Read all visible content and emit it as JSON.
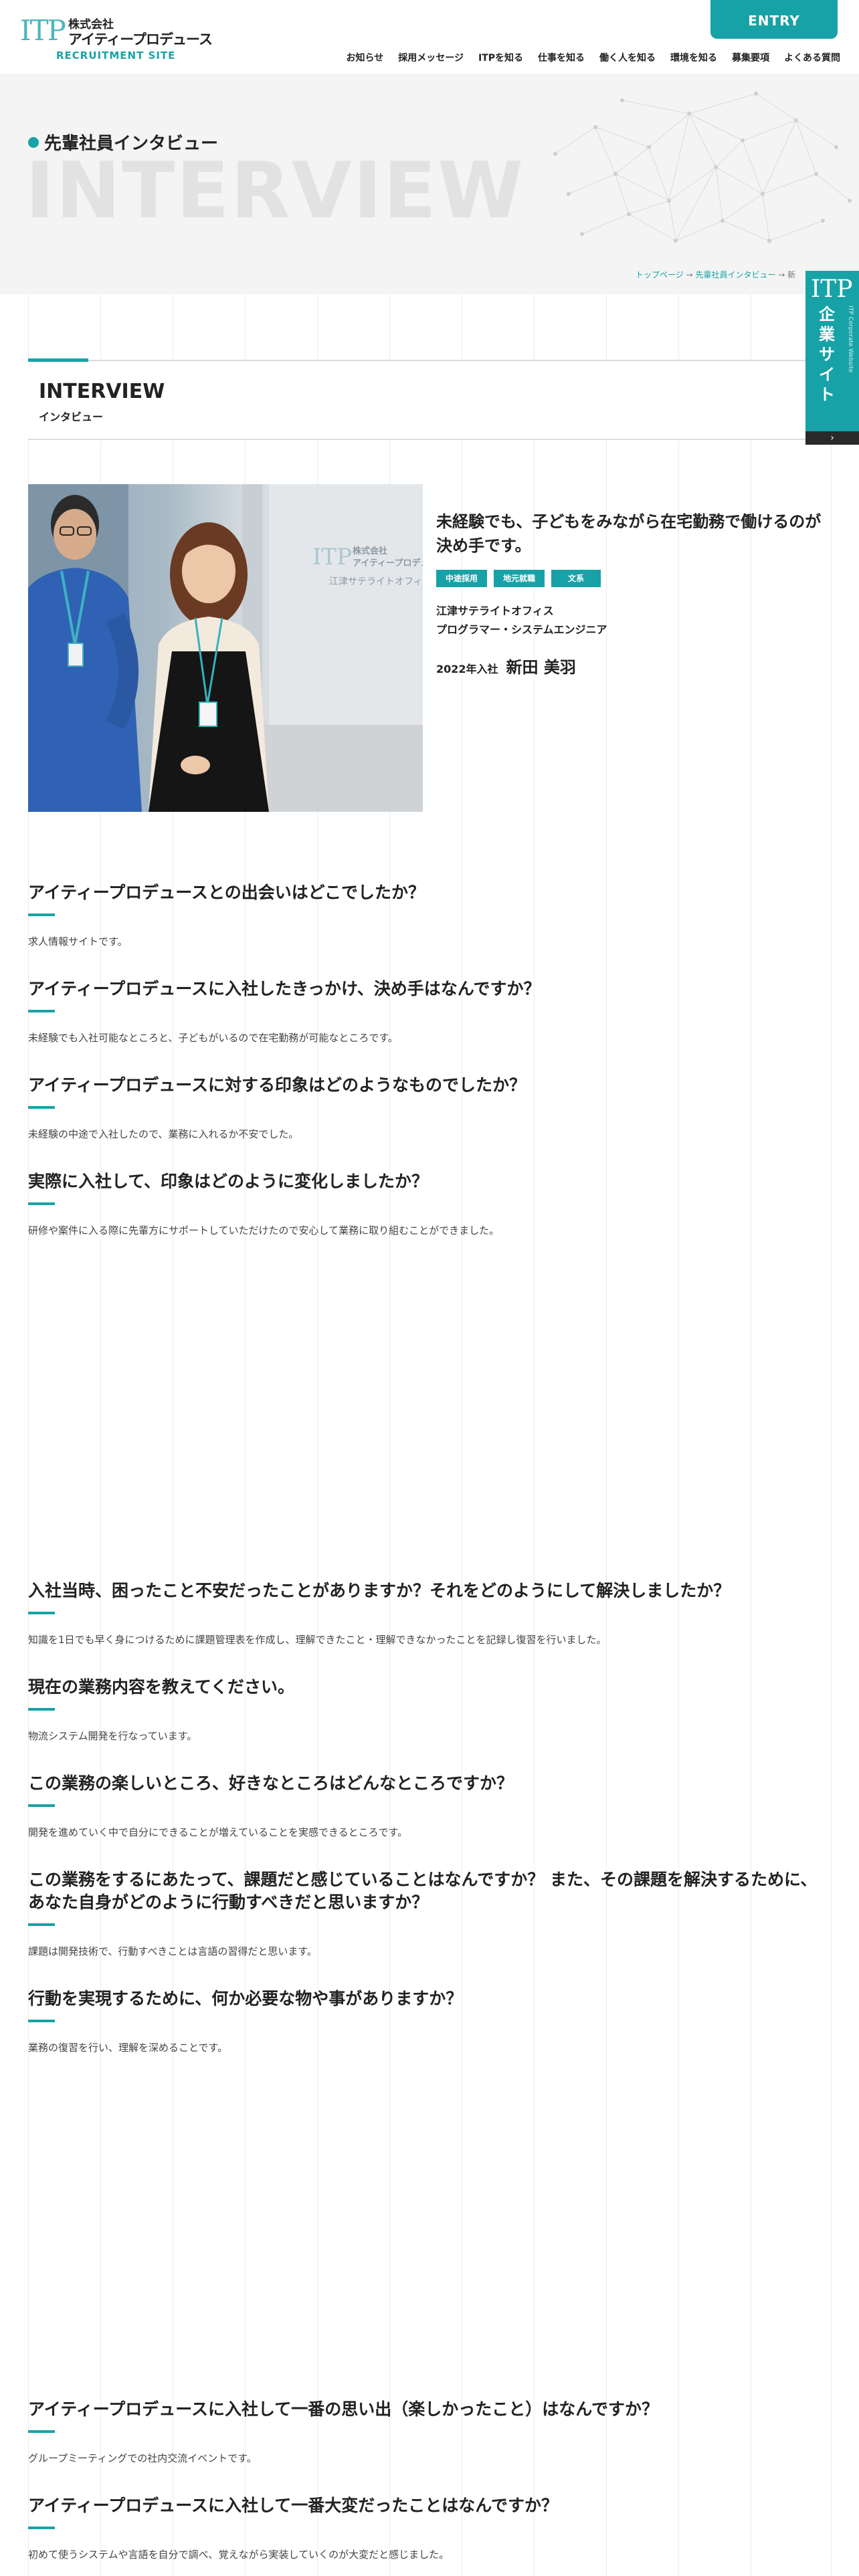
{
  "header": {
    "logo": {
      "itp": "ITP",
      "name_line1": "株式会社",
      "name_line2": "アイティープロデュース",
      "subtitle": "RECRUITMENT SITE"
    },
    "entry_label": "ENTRY",
    "nav": [
      "お知らせ",
      "採用メッセージ",
      "ITPを知る",
      "仕事を知る",
      "働く人を知る",
      "環境を知る",
      "募集要項",
      "よくある質問"
    ]
  },
  "hero": {
    "title": "先輩社員インタビュー",
    "title_en": "INTERVIEW"
  },
  "breadcrumb": {
    "home": "トップページ",
    "sep1": " → ",
    "parent": "先輩社員インタビュー",
    "sep2": " → ",
    "current": "新"
  },
  "side_tab": {
    "itp": "ITP",
    "label": "企業サイト",
    "small": "ITP Corporate Website",
    "arrow": "›"
  },
  "section": {
    "title_en": "INTERVIEW",
    "title_jp": "インタビュー"
  },
  "profile": {
    "catch": "未経験でも、子どもをみながら在宅勤務で働けるのが決め手です。",
    "tags": [
      "中途採用",
      "地元就職",
      "文系"
    ],
    "office": "江津サテライトオフィス",
    "job": "プログラマー・システムエンジニア",
    "joined_year": "2022年入社",
    "name": "新田 美羽",
    "photo_sign_itp": "ITP",
    "photo_sign_line1": "株式会社",
    "photo_sign_line2": "アイティープロデュース",
    "photo_sign_office": "江津サテライトオフィ"
  },
  "qa": [
    {
      "q": "アイティープロデュースとの出会いはどこでしたか？",
      "a": "求人情報サイトです。"
    },
    {
      "q": "アイティープロデュースに入社したきっかけ、決め手はなんですか？",
      "a": "未経験でも入社可能なところと、子どもがいるので在宅勤務が可能なところです。"
    },
    {
      "q": "アイティープロデュースに対する印象はどのようなものでしたか？",
      "a": "未経験の中途で入社したので、業務に入れるか不安でした。"
    },
    {
      "q": "実際に入社して、印象はどのように変化しましたか？",
      "a": "研修や案件に入る際に先輩方にサポートしていただけたので安心して業務に取り組むことができました。"
    },
    {
      "q": "入社当時、困ったこと不安だったことがありますか？それをどのようにして解決しましたか？",
      "a": "知識を1日でも早く身につけるために課題管理表を作成し、理解できたこと・理解できなかったことを記録し復習を行いました。"
    },
    {
      "q": "現在の業務内容を教えてください。",
      "a": "物流システム開発を行なっています。"
    },
    {
      "q": "この業務の楽しいところ、好きなところはどんなところですか？",
      "a": "開発を進めていく中で自分にできることが増えていることを実感できるところです。"
    },
    {
      "q": "この業務をするにあたって、課題だと感じていることはなんですか？ また、その課題を解決するために、あなた自身がどのように行動すべきだと思いますか？",
      "a": "課題は開発技術で、行動すべきことは言語の習得だと思います。"
    },
    {
      "q": "行動を実現するために、何か必要な物や事がありますか？",
      "a": "業務の復習を行い、理解を深めることです。"
    },
    {
      "q": "アイティープロデュースに入社して一番の思い出（楽しかったこと）はなんですか？",
      "a": "グループミーティングでの社内交流イベントです。"
    },
    {
      "q": "アイティープロデュースに入社して一番大変だったことはなんですか？",
      "a": "初めて使うシステムや言語を自分で調べ、覚えながら実装していくのが大変だと感じました。"
    }
  ],
  "colors": {
    "accent": "#17a2a7",
    "hero_bg": "#f4f4f4",
    "text": "#222222"
  }
}
